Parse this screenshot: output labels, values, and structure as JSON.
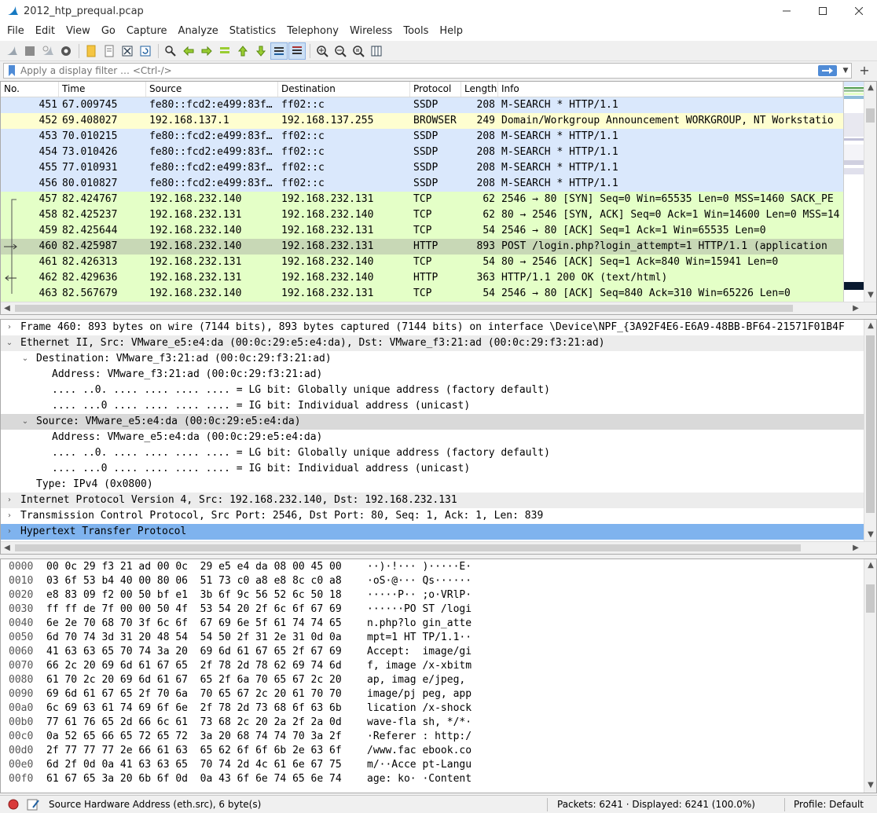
{
  "window": {
    "title": "2012_htp_prequal.pcap"
  },
  "menu": [
    "File",
    "Edit",
    "View",
    "Go",
    "Capture",
    "Analyze",
    "Statistics",
    "Telephony",
    "Wireless",
    "Tools",
    "Help"
  ],
  "filter": {
    "placeholder": "Apply a display filter … <Ctrl-/>"
  },
  "packet_list": {
    "columns": [
      "No.",
      "Time",
      "Source",
      "Destination",
      "Protocol",
      "Length",
      "Info"
    ],
    "rows": [
      {
        "no": "451",
        "time": "67.009745",
        "src": "fe80::fcd2:e499:83f…",
        "dst": "ff02::c",
        "proto": "SSDP",
        "len": "208",
        "info": "M-SEARCH * HTTP/1.1",
        "color": "#dae8fc"
      },
      {
        "no": "452",
        "time": "69.408027",
        "src": "192.168.137.1",
        "dst": "192.168.137.255",
        "proto": "BROWSER",
        "len": "249",
        "info": "Domain/Workgroup Announcement WORKGROUP, NT Workstatio",
        "color": "#fefed0"
      },
      {
        "no": "453",
        "time": "70.010215",
        "src": "fe80::fcd2:e499:83f…",
        "dst": "ff02::c",
        "proto": "SSDP",
        "len": "208",
        "info": "M-SEARCH * HTTP/1.1",
        "color": "#dae8fc"
      },
      {
        "no": "454",
        "time": "73.010426",
        "src": "fe80::fcd2:e499:83f…",
        "dst": "ff02::c",
        "proto": "SSDP",
        "len": "208",
        "info": "M-SEARCH * HTTP/1.1",
        "color": "#dae8fc"
      },
      {
        "no": "455",
        "time": "77.010931",
        "src": "fe80::fcd2:e499:83f…",
        "dst": "ff02::c",
        "proto": "SSDP",
        "len": "208",
        "info": "M-SEARCH * HTTP/1.1",
        "color": "#dae8fc"
      },
      {
        "no": "456",
        "time": "80.010827",
        "src": "fe80::fcd2:e499:83f…",
        "dst": "ff02::c",
        "proto": "SSDP",
        "len": "208",
        "info": "M-SEARCH * HTTP/1.1",
        "color": "#dae8fc"
      },
      {
        "no": "457",
        "time": "82.424767",
        "src": "192.168.232.140",
        "dst": "192.168.232.131",
        "proto": "TCP",
        "len": "62",
        "info": "2546 → 80 [SYN] Seq=0 Win=65535 Len=0 MSS=1460 SACK_PE",
        "color": "#e4ffc7"
      },
      {
        "no": "458",
        "time": "82.425237",
        "src": "192.168.232.131",
        "dst": "192.168.232.140",
        "proto": "TCP",
        "len": "62",
        "info": "80 → 2546 [SYN, ACK] Seq=0 Ack=1 Win=14600 Len=0 MSS=14",
        "color": "#e4ffc7"
      },
      {
        "no": "459",
        "time": "82.425644",
        "src": "192.168.232.140",
        "dst": "192.168.232.131",
        "proto": "TCP",
        "len": "54",
        "info": "2546 → 80 [ACK] Seq=1 Ack=1 Win=65535 Len=0",
        "color": "#e4ffc7"
      },
      {
        "no": "460",
        "time": "82.425987",
        "src": "192.168.232.140",
        "dst": "192.168.232.131",
        "proto": "HTTP",
        "len": "893",
        "info": "POST /login.php?login_attempt=1 HTTP/1.1  (application",
        "color": "#c8d8b6"
      },
      {
        "no": "461",
        "time": "82.426313",
        "src": "192.168.232.131",
        "dst": "192.168.232.140",
        "proto": "TCP",
        "len": "54",
        "info": "80 → 2546 [ACK] Seq=1 Ack=840 Win=15941 Len=0",
        "color": "#e4ffc7"
      },
      {
        "no": "462",
        "time": "82.429636",
        "src": "192.168.232.131",
        "dst": "192.168.232.140",
        "proto": "HTTP",
        "len": "363",
        "info": "HTTP/1.1 200 OK  (text/html)",
        "color": "#e4ffc7"
      },
      {
        "no": "463",
        "time": "82.567679",
        "src": "192.168.232.140",
        "dst": "192.168.232.131",
        "proto": "TCP",
        "len": "54",
        "info": "2546 → 80 [ACK] Seq=840 Ack=310 Win=65226 Len=0",
        "color": "#e4ffc7"
      }
    ]
  },
  "details": [
    {
      "indent": 0,
      "twisty": "›",
      "text": "Frame 460: 893 bytes on wire (7144 bits), 893 bytes captured (7144 bits) on interface \\Device\\NPF_{3A92F4E6-E6A9-48BB-BF64-21571F01B4F",
      "style": ""
    },
    {
      "indent": 0,
      "twisty": "⌄",
      "text": "Ethernet II, Src: VMware_e5:e4:da (00:0c:29:e5:e4:da), Dst: VMware_f3:21:ad (00:0c:29:f3:21:ad)",
      "style": "grey"
    },
    {
      "indent": 1,
      "twisty": "⌄",
      "text": "Destination: VMware_f3:21:ad (00:0c:29:f3:21:ad)",
      "style": ""
    },
    {
      "indent": 2,
      "twisty": "",
      "text": "Address: VMware_f3:21:ad (00:0c:29:f3:21:ad)",
      "style": ""
    },
    {
      "indent": 2,
      "twisty": "",
      "text": ".... ..0. .... .... .... .... = LG bit: Globally unique address (factory default)",
      "style": ""
    },
    {
      "indent": 2,
      "twisty": "",
      "text": ".... ...0 .... .... .... .... = IG bit: Individual address (unicast)",
      "style": ""
    },
    {
      "indent": 1,
      "twisty": "⌄",
      "text": "Source: VMware_e5:e4:da (00:0c:29:e5:e4:da)",
      "style": "sel-grey"
    },
    {
      "indent": 2,
      "twisty": "",
      "text": "Address: VMware_e5:e4:da (00:0c:29:e5:e4:da)",
      "style": ""
    },
    {
      "indent": 2,
      "twisty": "",
      "text": ".... ..0. .... .... .... .... = LG bit: Globally unique address (factory default)",
      "style": ""
    },
    {
      "indent": 2,
      "twisty": "",
      "text": ".... ...0 .... .... .... .... = IG bit: Individual address (unicast)",
      "style": ""
    },
    {
      "indent": 1,
      "twisty": "",
      "text": "Type: IPv4 (0x0800)",
      "style": ""
    },
    {
      "indent": 0,
      "twisty": "›",
      "text": "Internet Protocol Version 4, Src: 192.168.232.140, Dst: 192.168.232.131",
      "style": "grey"
    },
    {
      "indent": 0,
      "twisty": "›",
      "text": "Transmission Control Protocol, Src Port: 2546, Dst Port: 80, Seq: 1, Ack: 1, Len: 839",
      "style": ""
    },
    {
      "indent": 0,
      "twisty": "›",
      "text": "Hypertext Transfer Protocol",
      "style": "sel-blue"
    }
  ],
  "bytes": [
    {
      "off": "0000",
      "hex": "00 0c 29 f3 21 ad 00 0c  29 e5 e4 da 08 00 45 00",
      "asc": "··)·!··· )·····E·"
    },
    {
      "off": "0010",
      "hex": "03 6f 53 b4 40 00 80 06  51 73 c0 a8 e8 8c c0 a8",
      "asc": "·oS·@··· Qs······"
    },
    {
      "off": "0020",
      "hex": "e8 83 09 f2 00 50 bf e1  3b 6f 9c 56 52 6c 50 18",
      "asc": "·····P·· ;o·VRlP·"
    },
    {
      "off": "0030",
      "hex": "ff ff de 7f 00 00 50 4f  53 54 20 2f 6c 6f 67 69",
      "asc": "······PO ST /logi"
    },
    {
      "off": "0040",
      "hex": "6e 2e 70 68 70 3f 6c 6f  67 69 6e 5f 61 74 74 65",
      "asc": "n.php?lo gin_atte"
    },
    {
      "off": "0050",
      "hex": "6d 70 74 3d 31 20 48 54  54 50 2f 31 2e 31 0d 0a",
      "asc": "mpt=1 HT TP/1.1··"
    },
    {
      "off": "0060",
      "hex": "41 63 63 65 70 74 3a 20  69 6d 61 67 65 2f 67 69",
      "asc": "Accept:  image/gi"
    },
    {
      "off": "0070",
      "hex": "66 2c 20 69 6d 61 67 65  2f 78 2d 78 62 69 74 6d",
      "asc": "f, image /x-xbitm"
    },
    {
      "off": "0080",
      "hex": "61 70 2c 20 69 6d 61 67  65 2f 6a 70 65 67 2c 20",
      "asc": "ap, imag e/jpeg, "
    },
    {
      "off": "0090",
      "hex": "69 6d 61 67 65 2f 70 6a  70 65 67 2c 20 61 70 70",
      "asc": "image/pj peg, app"
    },
    {
      "off": "00a0",
      "hex": "6c 69 63 61 74 69 6f 6e  2f 78 2d 73 68 6f 63 6b",
      "asc": "lication /x-shock"
    },
    {
      "off": "00b0",
      "hex": "77 61 76 65 2d 66 6c 61  73 68 2c 20 2a 2f 2a 0d",
      "asc": "wave-fla sh, */*·"
    },
    {
      "off": "00c0",
      "hex": "0a 52 65 66 65 72 65 72  3a 20 68 74 74 70 3a 2f",
      "asc": "·Referer : http:/"
    },
    {
      "off": "00d0",
      "hex": "2f 77 77 77 2e 66 61 63  65 62 6f 6f 6b 2e 63 6f",
      "asc": "/www.fac ebook.co"
    },
    {
      "off": "00e0",
      "hex": "6d 2f 0d 0a 41 63 63 65  70 74 2d 4c 61 6e 67 75",
      "asc": "m/··Acce pt-Langu"
    },
    {
      "off": "00f0",
      "hex": "61 67 65 3a 20 6b 6f 0d  0a 43 6f 6e 74 65 6e 74",
      "asc": "age: ko· ·Content"
    }
  ],
  "status": {
    "field": "Source Hardware Address (eth.src), 6 byte(s)",
    "packets": "Packets: 6241 · Displayed: 6241 (100.0%)",
    "profile": "Profile: Default"
  }
}
